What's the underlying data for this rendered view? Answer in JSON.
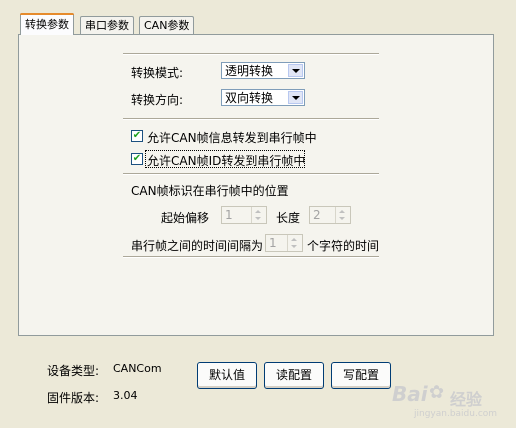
{
  "tabs": [
    {
      "label": "转换参数"
    },
    {
      "label": "串口参数"
    },
    {
      "label": "CAN参数"
    }
  ],
  "convert": {
    "mode_label": "转换模式:",
    "mode_value": "透明转换",
    "direction_label": "转换方向:",
    "direction_value": "双向转换"
  },
  "options": {
    "allow_info_label": "允许CAN帧信息转发到串行帧中",
    "allow_info_checked": true,
    "allow_id_label": "允许CAN帧ID转发到串行帧中",
    "allow_id_checked": true
  },
  "position": {
    "heading": "CAN帧标识在串行帧中的位置",
    "offset_label": "起始偏移",
    "offset_value": "1",
    "length_label": "长度",
    "length_value": "2"
  },
  "interval": {
    "prefix": "串行帧之间的时间间隔为",
    "value": "1",
    "suffix": "个字符的时间"
  },
  "device": {
    "type_label": "设备类型:",
    "type_value": "CANCom",
    "firmware_label": "固件版本:",
    "firmware_value": "3.04"
  },
  "buttons": {
    "default": "默认值",
    "read": "读配置",
    "write": "写配置"
  },
  "watermark": {
    "brand": "Bai",
    "suffix": "经验",
    "url": "jingyan.baidu.com"
  }
}
